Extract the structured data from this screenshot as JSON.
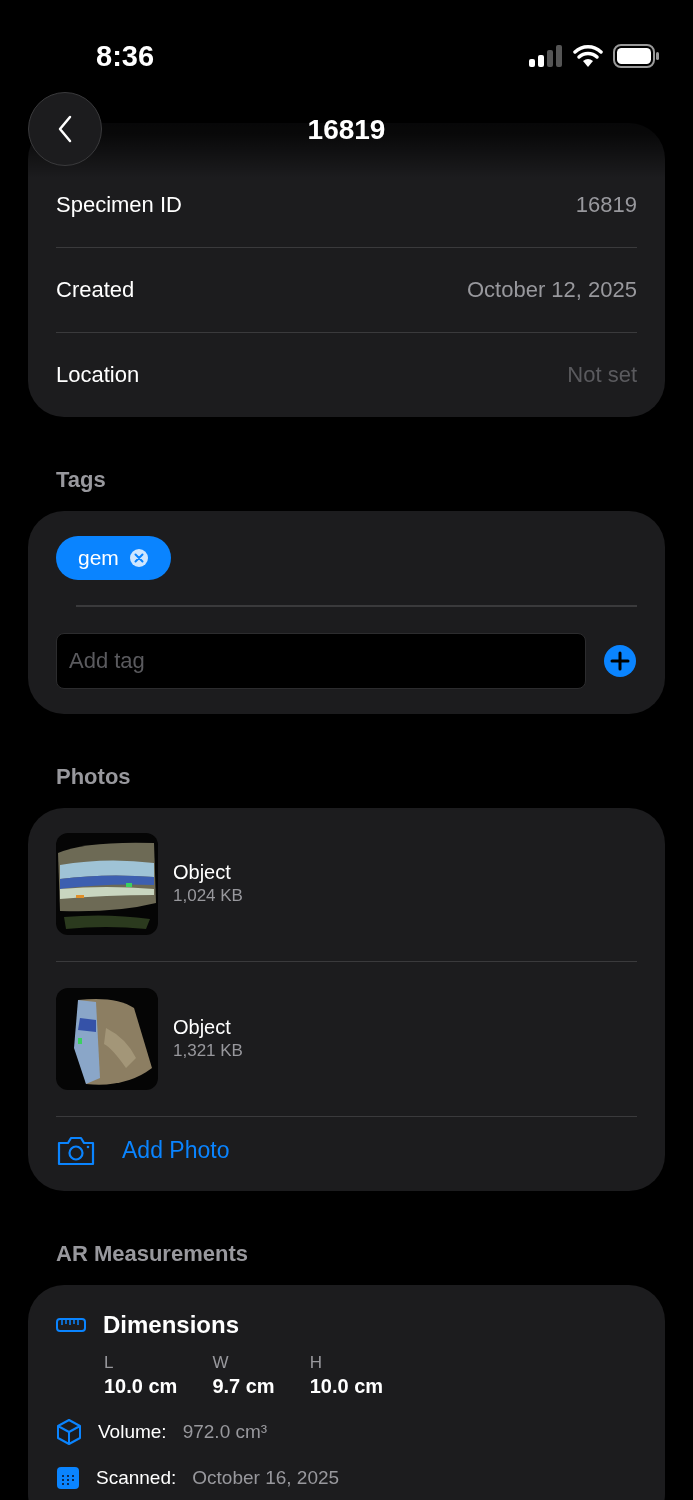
{
  "status_bar": {
    "time": "8:36"
  },
  "nav": {
    "title": "16819"
  },
  "basic_info": {
    "rows": [
      {
        "label": "Specimen ID",
        "value": "16819",
        "kind": "value"
      },
      {
        "label": "Created",
        "value": "October 12, 2025",
        "kind": "value"
      },
      {
        "label": "Location",
        "value": "Not set",
        "kind": "placeholder"
      }
    ]
  },
  "tags": {
    "heading": "Tags",
    "items": [
      {
        "label": "gem",
        "color": "#0a84ff"
      }
    ],
    "input": {
      "placeholder": "Add tag"
    }
  },
  "photos": {
    "heading": "Photos",
    "items": [
      {
        "kind": "picture",
        "name": "Object",
        "size": "1,024 KB"
      },
      {
        "kind": "picture",
        "name": "Object",
        "size": "1,321 KB"
      }
    ],
    "add_label": "Add Photo"
  },
  "ar": {
    "heading": "AR Measurements",
    "title": "Dimensions",
    "dims": [
      {
        "axis": "L",
        "value": "10.0 cm"
      },
      {
        "axis": "W",
        "value": "9.7 cm"
      },
      {
        "axis": "H",
        "value": "10.0 cm"
      }
    ],
    "volume": {
      "label": "Volume:",
      "value": "972.0 cm³"
    },
    "scanned": {
      "label": "Scanned:",
      "value": "October 16, 2025"
    }
  }
}
